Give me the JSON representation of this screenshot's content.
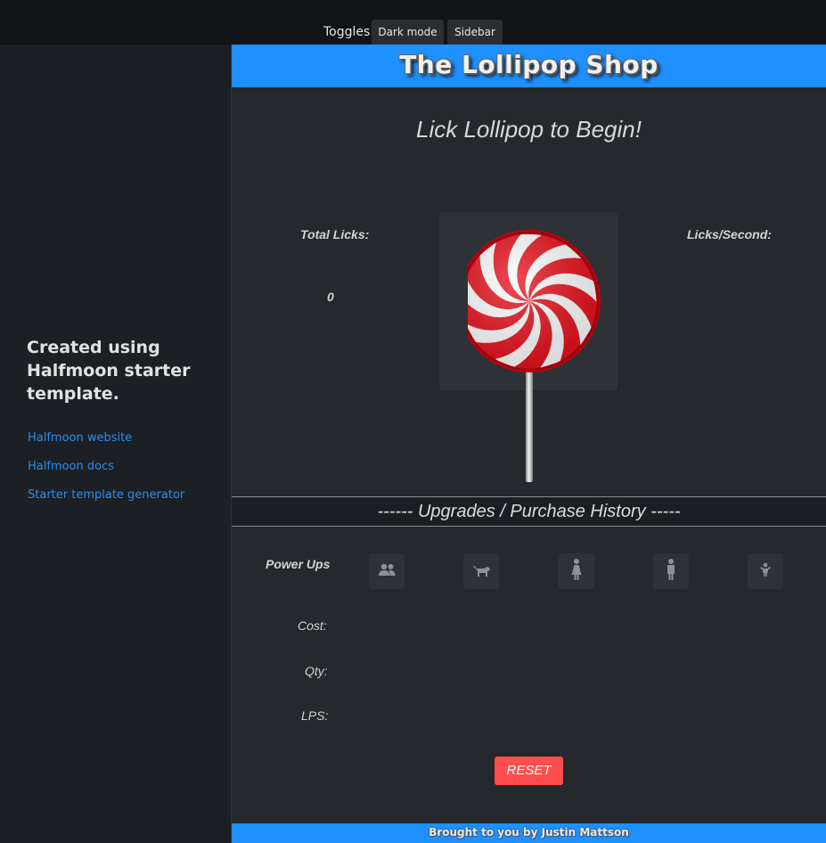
{
  "topbar": {
    "toggles_label": "Toggles:",
    "dark_mode_label": "Dark mode",
    "sidebar_label": "Sidebar"
  },
  "sidebar": {
    "title": "Created using Halfmoon starter template.",
    "links": [
      {
        "label": "Halfmoon website"
      },
      {
        "label": "Halfmoon docs"
      },
      {
        "label": "Starter template generator"
      }
    ]
  },
  "header": {
    "title": "The Lollipop Shop"
  },
  "game": {
    "prompt": "Lick Lollipop to Begin!",
    "total_licks_label": "Total Licks:",
    "total_licks_value": "0",
    "lps_label": "Licks/Second:",
    "lps_value": ""
  },
  "upgrades": {
    "title": "------ Upgrades / Purchase History -----",
    "powerups_label": "Power Ups",
    "cost_label": "Cost:",
    "qty_label": "Qty:",
    "lps_label": "LPS:",
    "powerups": [
      {
        "icon": "users-icon"
      },
      {
        "icon": "dog-icon"
      },
      {
        "icon": "woman-icon"
      },
      {
        "icon": "man-icon"
      },
      {
        "icon": "child-icon"
      }
    ],
    "reset_label": "RESET"
  },
  "footer": {
    "text": "Brought to you by Justin Mattson"
  },
  "colors": {
    "accent_blue": "#1e90ff",
    "reset_red": "#ff4d4d",
    "link_blue": "#2a8ef0",
    "background": "#25282c"
  }
}
